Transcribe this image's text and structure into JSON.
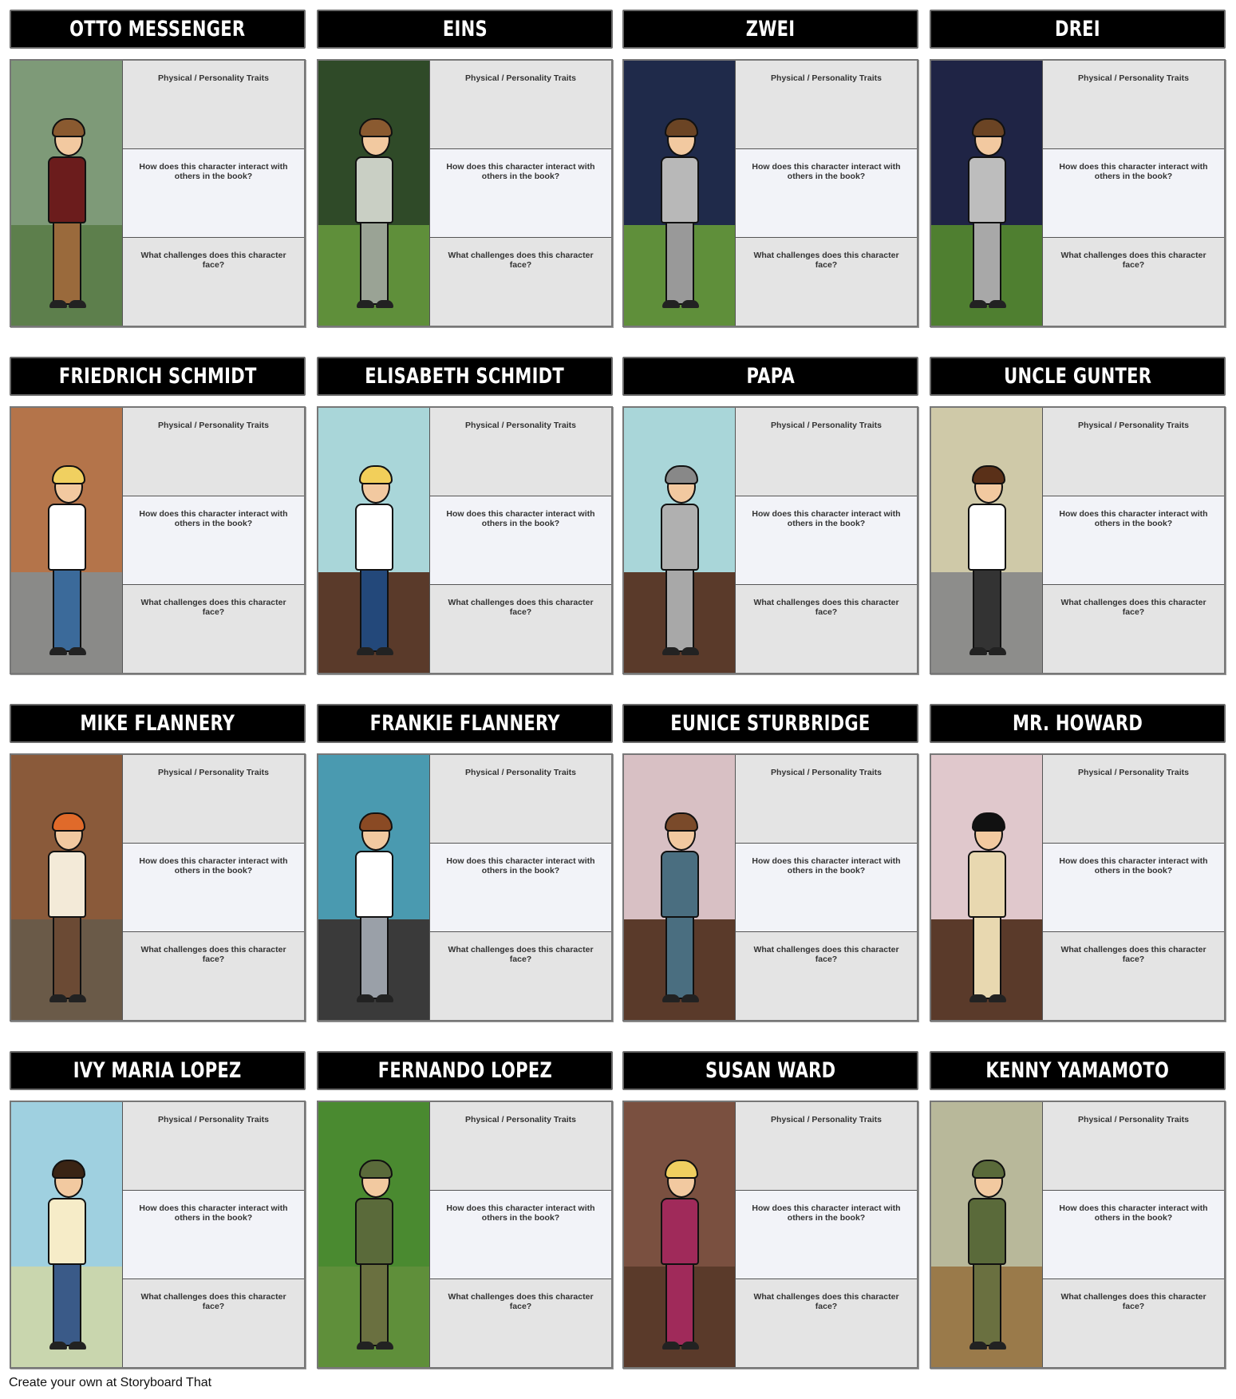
{
  "prompts": {
    "traits": "Physical / Personality Traits",
    "interact": "How does this character interact with others in the book?",
    "challenges": "What challenges does this character face?"
  },
  "cards": [
    {
      "name": "OTTO MESSENGER",
      "scene": [
        "#7e9a78",
        "#5d7f4c"
      ],
      "outfit": [
        "#6b1c1c",
        "#9a6a3c"
      ],
      "hair": "#8a5a30"
    },
    {
      "name": "EINS",
      "scene": [
        "#2f4a28",
        "#5f8f3a"
      ],
      "outfit": [
        "#c9cfc4",
        "#9aa395"
      ],
      "hair": "#8a5a30"
    },
    {
      "name": "ZWEI",
      "scene": [
        "#1f2a4a",
        "#5f8f3a"
      ],
      "outfit": [
        "#b8b8b8",
        "#999999"
      ],
      "hair": "#6b4424"
    },
    {
      "name": "DREI",
      "scene": [
        "#1f2445",
        "#4f7f30"
      ],
      "outfit": [
        "#bdbdbd",
        "#a8a8a8"
      ],
      "hair": "#6b4424"
    },
    {
      "name": "FRIEDRICH SCHMIDT",
      "scene": [
        "#b4744a",
        "#8a8a88"
      ],
      "outfit": [
        "#ffffff",
        "#3b6a9a"
      ],
      "hair": "#f0d060"
    },
    {
      "name": "ELISABETH SCHMIDT",
      "scene": [
        "#a9d6d9",
        "#5a3a2a"
      ],
      "outfit": [
        "#ffffff",
        "#23487a"
      ],
      "hair": "#f2cf5a"
    },
    {
      "name": "PAPA",
      "scene": [
        "#a9d6d9",
        "#5a3a2a"
      ],
      "outfit": [
        "#b0b0b0",
        "#a8a8a8"
      ],
      "hair": "#888888"
    },
    {
      "name": "UNCLE GUNTER",
      "scene": [
        "#cfc9a8",
        "#8d8d8b"
      ],
      "outfit": [
        "#ffffff",
        "#333333"
      ],
      "hair": "#5a3018"
    },
    {
      "name": "MIKE FLANNERY",
      "scene": [
        "#8a5a3a",
        "#6a5a48"
      ],
      "outfit": [
        "#f3ead8",
        "#6b4a34"
      ],
      "hair": "#e06a2a"
    },
    {
      "name": "FRANKIE FLANNERY",
      "scene": [
        "#4a9ab0",
        "#3a3a3a"
      ],
      "outfit": [
        "#ffffff",
        "#9aa0a8"
      ],
      "hair": "#8a4a24"
    },
    {
      "name": "EUNICE STURBRIDGE",
      "scene": [
        "#d8c0c4",
        "#5a3a2a"
      ],
      "outfit": [
        "#4a6e80",
        "#4a6e80"
      ],
      "hair": "#7a4a2a"
    },
    {
      "name": "MR. HOWARD",
      "scene": [
        "#e0c8cc",
        "#5a3a2a"
      ],
      "outfit": [
        "#e8d8b0",
        "#e8d8b0"
      ],
      "hair": "#111111"
    },
    {
      "name": "IVY MARIA LOPEZ",
      "scene": [
        "#9fd0e0",
        "#c9d6ae"
      ],
      "outfit": [
        "#f6ecc8",
        "#3a5a88"
      ],
      "hair": "#3a2414"
    },
    {
      "name": "FERNANDO LOPEZ",
      "scene": [
        "#4a8a30",
        "#5f8f3a"
      ],
      "outfit": [
        "#5a6a3a",
        "#6a7040"
      ],
      "hair": "#5a6a3a"
    },
    {
      "name": "SUSAN WARD",
      "scene": [
        "#7a5040",
        "#5a3a2a"
      ],
      "outfit": [
        "#a02a5a",
        "#a02a5a"
      ],
      "hair": "#f0cf60"
    },
    {
      "name": "KENNY YAMAMOTO",
      "scene": [
        "#b8b89a",
        "#9a7a4a"
      ],
      "outfit": [
        "#5a6a3a",
        "#6a7040"
      ],
      "hair": "#5a6a3a"
    }
  ],
  "footer": "Create your own at Storyboard That"
}
